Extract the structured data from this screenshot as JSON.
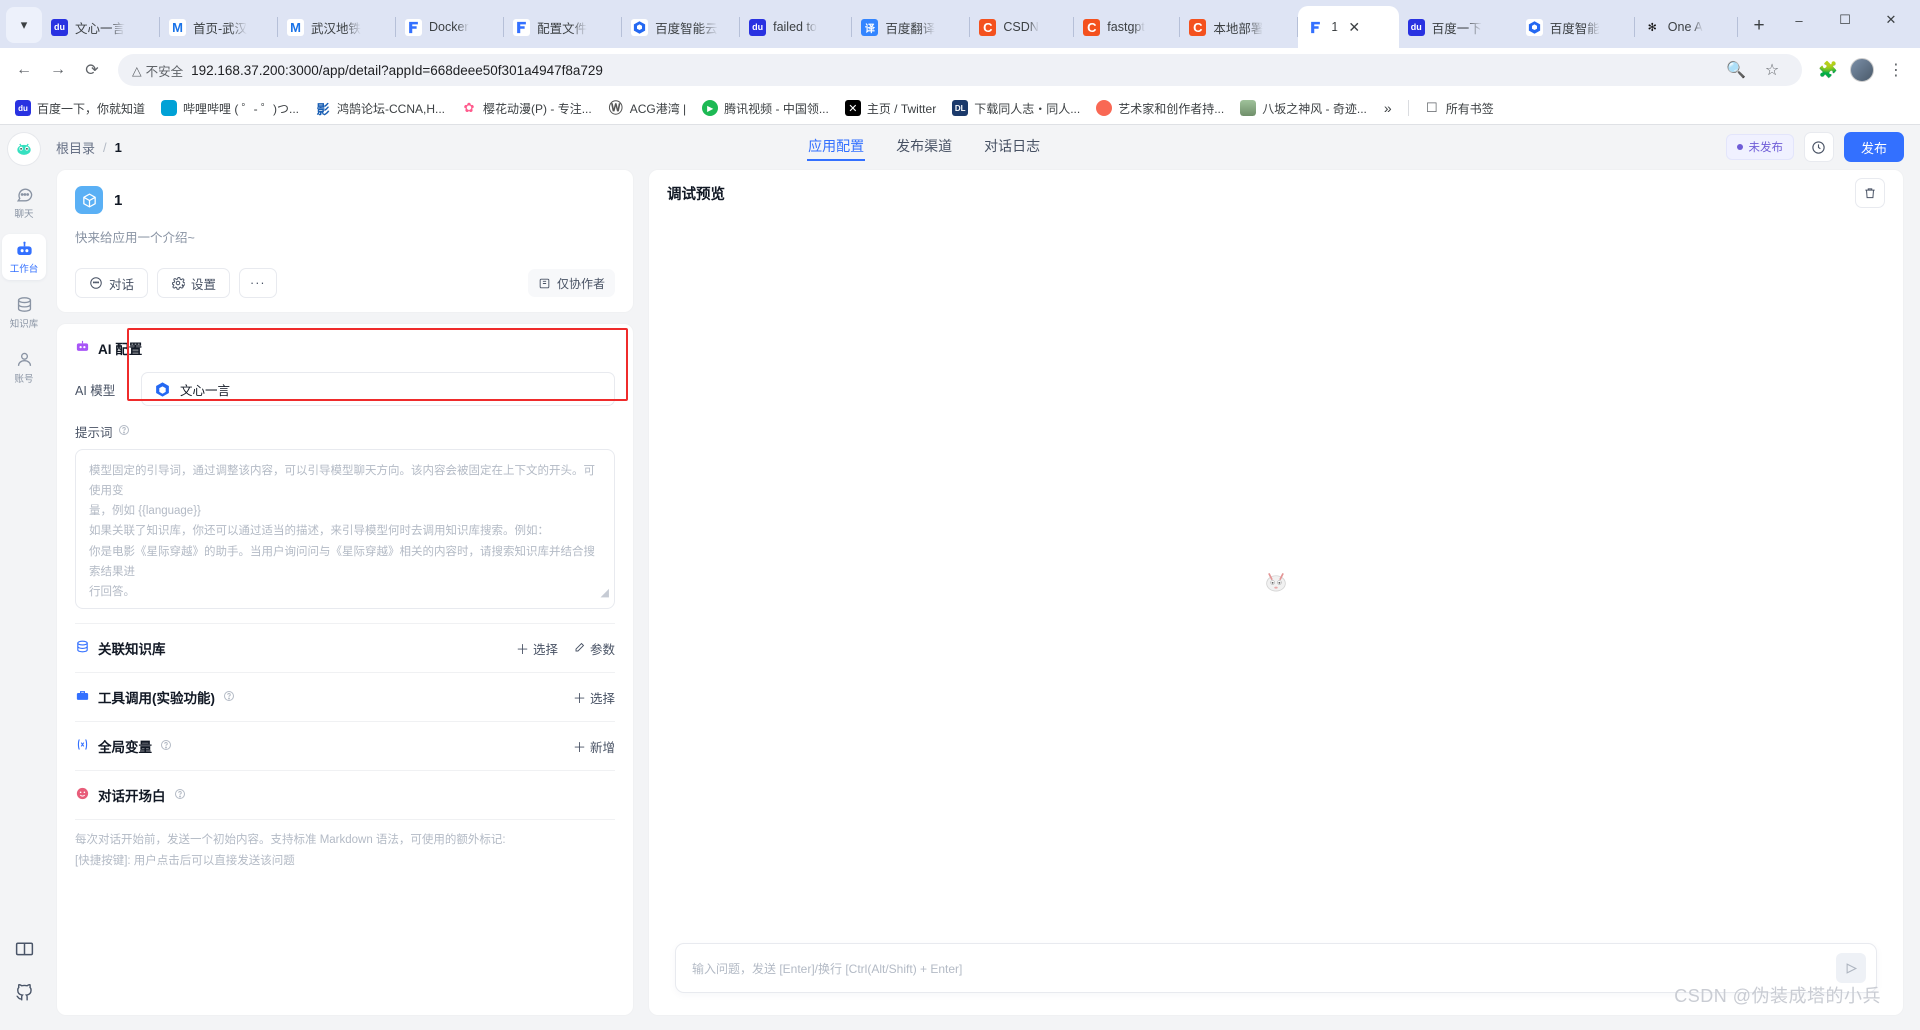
{
  "browser": {
    "tabs": [
      {
        "title": "文心一言",
        "icon": "baidu-icon",
        "active": false
      },
      {
        "title": "首页-武汉",
        "icon": "m-icon",
        "active": false
      },
      {
        "title": "武汉地铁",
        "icon": "m-icon",
        "active": false
      },
      {
        "title": "Docker",
        "icon": "fastgpt-icon",
        "active": false
      },
      {
        "title": "配置文件",
        "icon": "fastgpt-icon",
        "active": false
      },
      {
        "title": "百度智能云",
        "icon": "baiduyun-icon",
        "active": false
      },
      {
        "title": "failed to",
        "icon": "baidu-icon",
        "active": false
      },
      {
        "title": "百度翻译",
        "icon": "translate-icon",
        "active": false
      },
      {
        "title": "CSDN",
        "icon": "csdn-icon",
        "active": false
      },
      {
        "title": "fastgpt",
        "icon": "csdn-icon",
        "active": false
      },
      {
        "title": "本地部署",
        "icon": "csdn-icon",
        "active": false
      },
      {
        "title": "1",
        "icon": "fastgpt-icon",
        "active": true
      },
      {
        "title": "百度一下",
        "icon": "baidu-icon",
        "active": false
      },
      {
        "title": "百度智能",
        "icon": "baiduyun-icon",
        "active": false
      },
      {
        "title": "One A",
        "icon": "openai-icon",
        "active": false
      }
    ],
    "new_tab_label": "+",
    "window_controls": {
      "minimize": "–",
      "maximize": "☐",
      "close": "✕"
    },
    "nav": {
      "back": "←",
      "forward": "→",
      "reload": "⟳"
    },
    "address": {
      "security_label": "不安全",
      "url": "192.168.37.200:3000/app/detail?appId=668deee50f301a4947f8a729"
    },
    "bookmarks": [
      {
        "label": "百度一下，你就知道",
        "icon": "baidu-icon"
      },
      {
        "label": "哔哩哔哩 ( ゜- ゜)つ...",
        "icon": "bilibili-icon"
      },
      {
        "label": "鸿鹄论坛-CCNA,H...",
        "icon": "honghu-icon"
      },
      {
        "label": "樱花动漫(P) - 专注...",
        "icon": "sakura-icon"
      },
      {
        "label": "ACG港湾 |",
        "icon": "wordpress-icon"
      },
      {
        "label": "腾讯视频 - 中国领...",
        "icon": "tencent-video-icon"
      },
      {
        "label": "主页 / Twitter",
        "icon": "twitter-x-icon"
      },
      {
        "label": "下载同人志・同人...",
        "icon": "dl-icon"
      },
      {
        "label": "艺术家和创作者持...",
        "icon": "patreon-icon"
      },
      {
        "label": "八坂之神风 - 奇迹...",
        "icon": "avatar-icon"
      }
    ],
    "bookmarks_overflow": "»",
    "all_bookmarks_label": "所有书签"
  },
  "sidebar": {
    "logo": "fastgpt-logo",
    "items": [
      {
        "label": "聊天",
        "icon": "chat-icon",
        "active": false
      },
      {
        "label": "工作台",
        "icon": "robot-icon",
        "active": true
      },
      {
        "label": "知识库",
        "icon": "database-icon",
        "active": false
      },
      {
        "label": "账号",
        "icon": "user-icon",
        "active": false
      }
    ],
    "bottom_icons": [
      {
        "name": "docs-book-icon"
      },
      {
        "name": "github-icon"
      }
    ]
  },
  "header": {
    "breadcrumb": {
      "root": "根目录",
      "separator": "/",
      "current": "1"
    },
    "tabs": [
      {
        "label": "应用配置",
        "active": true
      },
      {
        "label": "发布渠道",
        "active": false
      },
      {
        "label": "对话日志",
        "active": false
      }
    ],
    "publish_status": "未发布",
    "history_icon": "clock-icon",
    "publish_button": "发布"
  },
  "app_card": {
    "icon": "app-cube-icon",
    "name": "1",
    "description": "快来给应用一个介绍~",
    "buttons": [
      {
        "label": "对话",
        "icon": "chat-bubble-icon"
      },
      {
        "label": "设置",
        "icon": "gear-icon"
      },
      {
        "label": "···",
        "icon": "more-icon"
      }
    ],
    "author_label": "仅协作者",
    "author_icon": "shield-icon"
  },
  "ai_config": {
    "section_title": "AI 配置",
    "section_icon": "robot-emoji-icon",
    "model_label": "AI 模型",
    "model_value": "文心一言",
    "model_icon": "wenxin-icon",
    "prompt_label": "提示词",
    "prompt_help_icon": "question-icon",
    "prompt_placeholder_lines": [
      "模型固定的引导词，通过调整该内容，可以引导模型聊天方向。该内容会被固定在上下文的开头。可使用变",
      "量，例如 {{language}}",
      "如果关联了知识库，你还可以通过适当的描述，来引导模型何时去调用知识库搜索。例如：",
      "你是电影《星际穿越》的助手。当用户询问问与《星际穿越》相关的内容时，请搜索知识库并结合搜索结果进",
      "行回答。"
    ],
    "resize_icon": "resize-handle-icon"
  },
  "sections": [
    {
      "title": "关联知识库",
      "icon": "kb-icon",
      "actions": [
        {
          "label": "选择",
          "icon": "plus-icon"
        },
        {
          "label": "参数",
          "icon": "edit-icon"
        }
      ]
    },
    {
      "title": "工具调用(实验功能)",
      "icon": "toolbox-icon",
      "help": true,
      "actions": [
        {
          "label": "选择",
          "icon": "plus-icon"
        }
      ]
    },
    {
      "title": "全局变量",
      "icon": "variable-icon",
      "help": true,
      "actions": [
        {
          "label": "新增",
          "icon": "plus-icon"
        }
      ]
    },
    {
      "title": "对话开场白",
      "icon": "welcome-icon",
      "help": true,
      "actions": []
    }
  ],
  "welcome_text": {
    "line1": "每次对话开始前，发送一个初始内容。支持标准 Markdown 语法，可使用的额外标记:",
    "line2": "[快捷按键]: 用户点击后可以直接发送该问题"
  },
  "preview": {
    "title": "调试预览",
    "restart_icon": "restart-icon",
    "empty_icon": "empty-bot-icon",
    "input_placeholder": "输入问题，发送 [Enter]/换行 [Ctrl(Alt/Shift) + Enter]",
    "send_icon": "send-icon"
  },
  "watermark": "CSDN @伪装成塔的小兵",
  "colors": {
    "accent": "#3370ff",
    "highlight_box": "#ef2b2b",
    "badge": "#6f5dd7",
    "tabstrip": "#dee4f4"
  }
}
